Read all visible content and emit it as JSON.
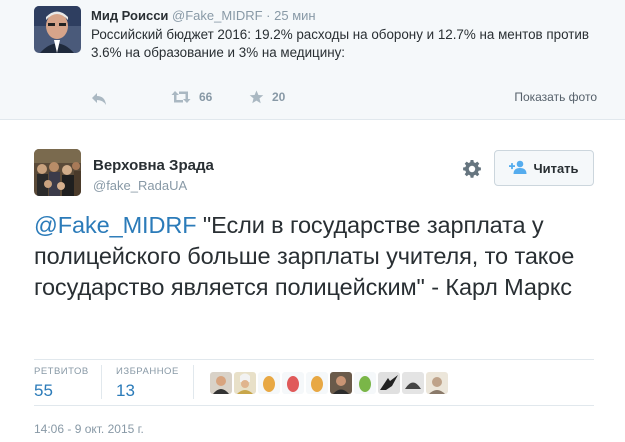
{
  "parent_tweet": {
    "author_name": "Мид Роисси",
    "author_handle": "@Fake_MIDRF",
    "separator": "·",
    "time": "25 мин",
    "text": "Российский бюджет 2016: 19.2% расходы на оборону и 12.7% на ментов против 3.6% на образование и 3% на медицину:",
    "actions": {
      "reply_icon": "reply-icon",
      "retweet_icon": "retweet-icon",
      "retweet_count": "66",
      "favorite_icon": "star-icon",
      "favorite_count": "20",
      "show_photo_label": "Показать фото"
    }
  },
  "main_tweet": {
    "author_name": "Верховна Зрада",
    "author_handle": "@fake_RadaUA",
    "settings_icon": "gear-icon",
    "follow_label": "Читать",
    "follow_icon": "add-user-icon",
    "mention": "@Fake_MIDRF",
    "text_body": " \"Если в государстве зарплата у полицейского больше зарплаты учителя, то такое государство является полицейским\" - Карл Маркс",
    "stats": {
      "retweets_label": "РЕТВИТОВ",
      "retweets_value": "55",
      "favorites_label": "ИЗБРАННОЕ",
      "favorites_value": "13"
    },
    "timestamp": "14:06 - 9 окт. 2015 г."
  },
  "colors": {
    "link": "#2b7bb9",
    "muted": "#8899a6",
    "text": "#292f33",
    "parent_bg": "#f5f8fa",
    "rule": "#e1e8ed"
  }
}
